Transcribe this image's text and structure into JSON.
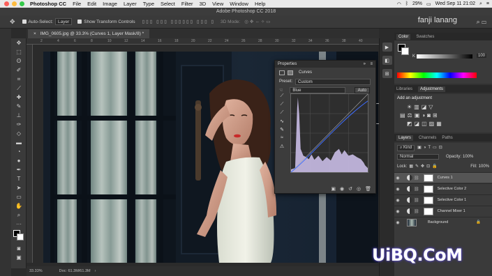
{
  "menubar": {
    "app": "Photoshop CC",
    "items": [
      "File",
      "Edit",
      "Image",
      "Layer",
      "Type",
      "Select",
      "Filter",
      "3D",
      "View",
      "Window",
      "Help"
    ],
    "battery": "29%",
    "datetime": "Wed Sep 11  21:02",
    "colors": {
      "close": "#fc605b",
      "minimize": "#fdbc40",
      "zoom": "#34c84a"
    }
  },
  "window": {
    "title": "Adobe Photoshop CC 2018"
  },
  "options": {
    "auto_select_label": "Auto-Select:",
    "auto_select_value": "Layer",
    "show_transform_label": "Show Transform Controls",
    "mode_3d": "3D Mode:",
    "user": "fanji lanang"
  },
  "document": {
    "tab": "IMG_0605.jpg @ 33.3% (Curves 1, Layer Mask/8) *",
    "zoom": "33.33%",
    "doc_info": "Doc: 61.3M/61.3M"
  },
  "ruler": {
    "ticks": [
      "2",
      "4",
      "6",
      "8",
      "10",
      "12",
      "14",
      "16",
      "18",
      "20",
      "22",
      "24",
      "26",
      "28",
      "30",
      "32",
      "34",
      "36",
      "38",
      "40"
    ]
  },
  "properties": {
    "title": "Properties",
    "adjustment": "Curves",
    "preset_label": "Preset:",
    "preset_value": "Custom",
    "channel": "Blue",
    "auto_label": "Auto"
  },
  "color_panel": {
    "tabs": [
      "Color",
      "Swatches"
    ],
    "k_label": "K",
    "k_value": "100"
  },
  "adjustments_panel": {
    "tabs": [
      "Libraries",
      "Adjustments"
    ],
    "heading": "Add an adjustment"
  },
  "layers_panel": {
    "tabs": [
      "Layers",
      "Channels",
      "Paths"
    ],
    "filter": "Kind",
    "blend_mode": "Normal",
    "opacity_label": "Opacity:",
    "opacity": "100%",
    "lock_label": "Lock:",
    "fill_label": "Fill:",
    "fill": "100%",
    "layers": [
      {
        "name": "Curves 1",
        "selected": true
      },
      {
        "name": "Selective Color 2",
        "selected": false
      },
      {
        "name": "Selective Color 1",
        "selected": false
      },
      {
        "name": "Channel Mixer 1",
        "selected": false
      },
      {
        "name": "Background",
        "selected": false
      }
    ]
  },
  "watermark": {
    "text": "UiBQ.CoM"
  }
}
